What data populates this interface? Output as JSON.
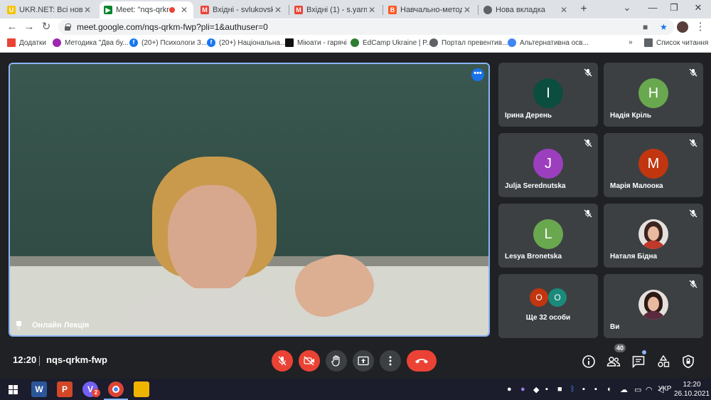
{
  "browser": {
    "tabs": [
      {
        "title": "UKR.NET: Всі новини",
        "favicon": "ukrnet-icon",
        "color": "#f5c300",
        "active": false
      },
      {
        "title": "Meet: \"nqs-qrkm-",
        "favicon": "meet-icon",
        "color": "#00832d",
        "active": true
      },
      {
        "title": "Вхідні - svlukovska@g",
        "favicon": "gmail-icon",
        "color": "#ea4335",
        "active": false
      },
      {
        "title": "Вхідні (1) - s.yarmolyt",
        "favicon": "gmail-icon",
        "color": "#ea4335",
        "active": false
      },
      {
        "title": "Навчально-методичн",
        "favicon": "blogger-icon",
        "color": "#ff5722",
        "active": false
      },
      {
        "title": "Нова вкладка",
        "favicon": "chrome-icon",
        "color": "#5f6368",
        "active": false
      }
    ],
    "url": "meet.google.com/nqs-qrkm-fwp?pli=1&authuser=0",
    "bookmarks": [
      {
        "label": "Додатки",
        "icon": "apps-grid-icon"
      },
      {
        "label": "Методика \"Два бу...",
        "icon": "bookmark-icon"
      },
      {
        "label": "(20+) Психологи З...",
        "icon": "facebook-icon"
      },
      {
        "label": "(20+) Національна...",
        "icon": "facebook-icon"
      },
      {
        "label": "Міюати - гарячі",
        "icon": "site-icon"
      },
      {
        "label": "EdCamp Ukraine | P...",
        "icon": "edcamp-icon"
      },
      {
        "label": "Портал превентив...",
        "icon": "globe-icon"
      },
      {
        "label": "Альтернативна осв...",
        "icon": "link-icon"
      }
    ],
    "reading_list": "Список читання",
    "overflow": "»"
  },
  "meet": {
    "presenter_name": "Онлайн Лекція",
    "participants": [
      {
        "name": "Ірина Дерень",
        "initial": "I",
        "color": "#0b4d3f"
      },
      {
        "name": "Надія Кріль",
        "initial": "H",
        "color": "#6aa84f"
      },
      {
        "name": "Julja Serednutska",
        "initial": "J",
        "color": "#9c3fbf"
      },
      {
        "name": "Марія Малоока",
        "initial": "M",
        "color": "#c1360f"
      },
      {
        "name": "Lesya Bronetska",
        "initial": "L",
        "color": "#6aa84f"
      },
      {
        "name": "Наталя Бідна",
        "photo": true
      },
      {
        "name": "Ви",
        "photo": true
      }
    ],
    "others": {
      "label": "Ще 32 особи",
      "initials": [
        "O",
        "O"
      ]
    },
    "time": "12:20",
    "code": "nqs-qrkm-fwp",
    "people_count": "40"
  },
  "taskbar": {
    "apps": [
      {
        "name": "word-icon",
        "glyph": "W",
        "color": "#2b579a"
      },
      {
        "name": "powerpoint-icon",
        "glyph": "P",
        "color": "#d24726"
      },
      {
        "name": "viber-icon",
        "glyph": "V",
        "color": "#7360f2"
      },
      {
        "name": "chrome-taskbar-icon",
        "glyph": "●",
        "color": "#db4437"
      },
      {
        "name": "explorer-icon",
        "glyph": "▬",
        "color": "#f0b400"
      }
    ],
    "viber_badge": "2",
    "lang": "УКР",
    "time": "12:20",
    "date": "26.10.2021"
  }
}
